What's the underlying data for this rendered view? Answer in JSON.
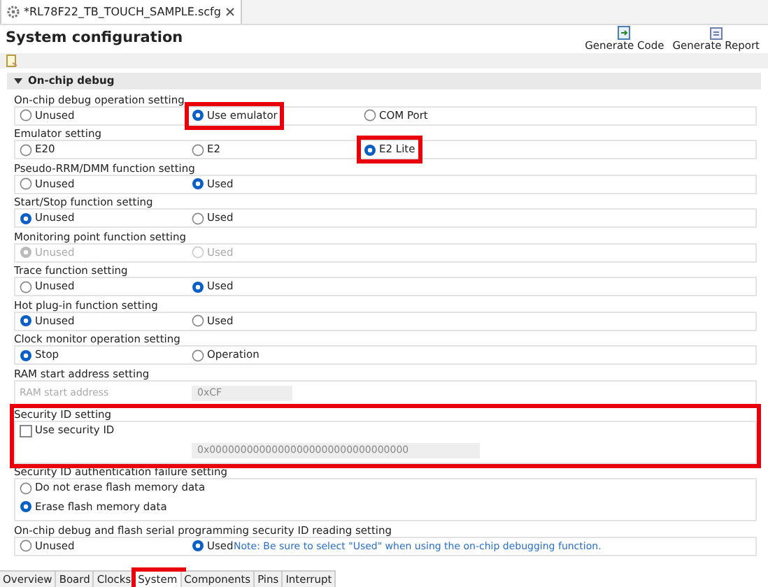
{
  "editor_tab": {
    "title": "*RL78F22_TB_TOUCH_SAMPLE.scfg"
  },
  "page_title": "System configuration",
  "toolbar_buttons": [
    {
      "label": "Generate Code",
      "kind": "code"
    },
    {
      "label": "Generate Report",
      "kind": "report"
    }
  ],
  "section": {
    "title": "On-chip debug",
    "expanded": true
  },
  "groups": [
    {
      "kind": "radio",
      "title": "On-chip debug operation setting",
      "options": [
        {
          "label": "Unused",
          "selected": false,
          "disabled": false
        },
        {
          "label": "Use emulator",
          "selected": true,
          "disabled": false,
          "highlighted": true
        },
        {
          "label": "COM Port",
          "selected": false,
          "disabled": false
        }
      ]
    },
    {
      "kind": "radio",
      "title": "Emulator setting",
      "options": [
        {
          "label": "E20",
          "selected": false,
          "disabled": false
        },
        {
          "label": "E2",
          "selected": false,
          "disabled": false
        },
        {
          "label": "E2 Lite",
          "selected": true,
          "disabled": false,
          "highlighted": true
        }
      ]
    },
    {
      "kind": "radio",
      "title": "Pseudo-RRM/DMM function setting",
      "options": [
        {
          "label": "Unused",
          "selected": false,
          "disabled": false
        },
        {
          "label": "Used",
          "selected": true,
          "disabled": false
        }
      ]
    },
    {
      "kind": "radio",
      "title": "Start/Stop function setting",
      "options": [
        {
          "label": "Unused",
          "selected": true,
          "disabled": false
        },
        {
          "label": "Used",
          "selected": false,
          "disabled": false
        }
      ]
    },
    {
      "kind": "radio",
      "title": "Monitoring point function setting",
      "options": [
        {
          "label": "Unused",
          "selected": true,
          "disabled": true
        },
        {
          "label": "Used",
          "selected": false,
          "disabled": true
        }
      ]
    },
    {
      "kind": "radio",
      "title": "Trace function setting",
      "options": [
        {
          "label": "Unused",
          "selected": false,
          "disabled": false
        },
        {
          "label": "Used",
          "selected": true,
          "disabled": false
        }
      ]
    },
    {
      "kind": "radio",
      "title": "Hot plug-in function setting",
      "options": [
        {
          "label": "Unused",
          "selected": true,
          "disabled": false
        },
        {
          "label": "Used",
          "selected": false,
          "disabled": false
        }
      ]
    },
    {
      "kind": "radio",
      "title": "Clock monitor operation setting",
      "options": [
        {
          "label": "Stop",
          "selected": true,
          "disabled": false
        },
        {
          "label": "Operation",
          "selected": false,
          "disabled": false
        }
      ]
    },
    {
      "kind": "field",
      "title": "RAM start address setting",
      "label": "RAM start address",
      "value": "0xCF",
      "disabled": true
    },
    {
      "kind": "checkbox_field",
      "title": "Security ID setting",
      "highlighted": true,
      "checkbox": {
        "label": "Use security ID",
        "checked": false
      },
      "value": "0x00000000000000000000000000000000",
      "disabled": true
    },
    {
      "kind": "radio_stack",
      "title": "Security ID authentication failure setting",
      "options": [
        {
          "label": "Do not erase flash memory data",
          "selected": false,
          "disabled": false
        },
        {
          "label": "Erase flash memory data",
          "selected": true,
          "disabled": false
        }
      ]
    },
    {
      "kind": "radio",
      "title": "On-chip debug and flash serial programming security ID reading setting",
      "options": [
        {
          "label": "Unused",
          "selected": false,
          "disabled": false
        },
        {
          "label": "Used",
          "selected": true,
          "disabled": false
        }
      ],
      "note": "Note: Be sure to select \"Used\" when using the on-chip debugging function."
    }
  ],
  "bottom_tabs": [
    {
      "label": "Overview",
      "selected": false
    },
    {
      "label": "Board",
      "selected": false
    },
    {
      "label": "Clocks",
      "selected": false
    },
    {
      "label": "System",
      "selected": true,
      "highlighted": true
    },
    {
      "label": "Components",
      "selected": false
    },
    {
      "label": "Pins",
      "selected": false
    },
    {
      "label": "Interrupt",
      "selected": false
    }
  ]
}
